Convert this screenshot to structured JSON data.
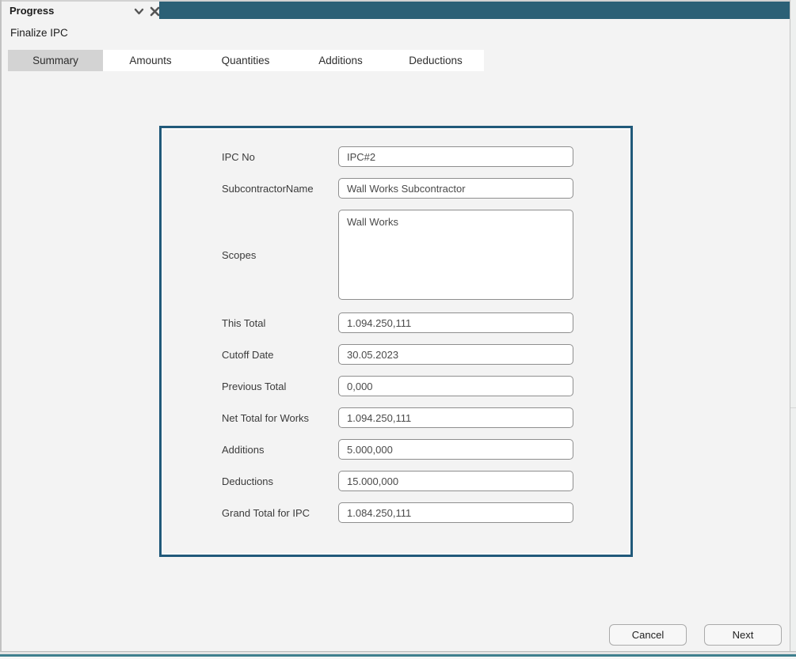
{
  "window": {
    "view_tab_title": "Progress"
  },
  "header": {
    "title": "Finalize IPC"
  },
  "tabs": [
    {
      "label": "Summary",
      "selected": true
    },
    {
      "label": "Amounts",
      "selected": false
    },
    {
      "label": "Quantities",
      "selected": false
    },
    {
      "label": "Additions",
      "selected": false
    },
    {
      "label": "Deductions",
      "selected": false
    }
  ],
  "form": {
    "fields": [
      {
        "label": "IPC No",
        "value": "IPC#2",
        "type": "text"
      },
      {
        "label": "SubcontractorName",
        "value": "Wall Works Subcontractor",
        "type": "text"
      },
      {
        "label": "Scopes",
        "value": "Wall Works",
        "type": "textarea"
      },
      {
        "label": "This Total",
        "value": "1.094.250,111",
        "type": "text"
      },
      {
        "label": "Cutoff Date",
        "value": "30.05.2023",
        "type": "text"
      },
      {
        "label": "Previous Total",
        "value": "0,000",
        "type": "text"
      },
      {
        "label": "Net Total for Works",
        "value": "1.094.250,111",
        "type": "text"
      },
      {
        "label": "Additions",
        "value": "5.000,000",
        "type": "text"
      },
      {
        "label": "Deductions",
        "value": "15.000,000",
        "type": "text"
      },
      {
        "label": "Grand Total for IPC",
        "value": "1.084.250,111",
        "type": "text"
      }
    ]
  },
  "footer": {
    "cancel_label": "Cancel",
    "next_label": "Next"
  },
  "colors": {
    "accent_teal": "#2b6076",
    "panel_border": "#20597a",
    "selected_tab_bg": "#d3d3d3",
    "bottom_line_teal": "#3e7f8e",
    "icon_gray": "#555555"
  }
}
